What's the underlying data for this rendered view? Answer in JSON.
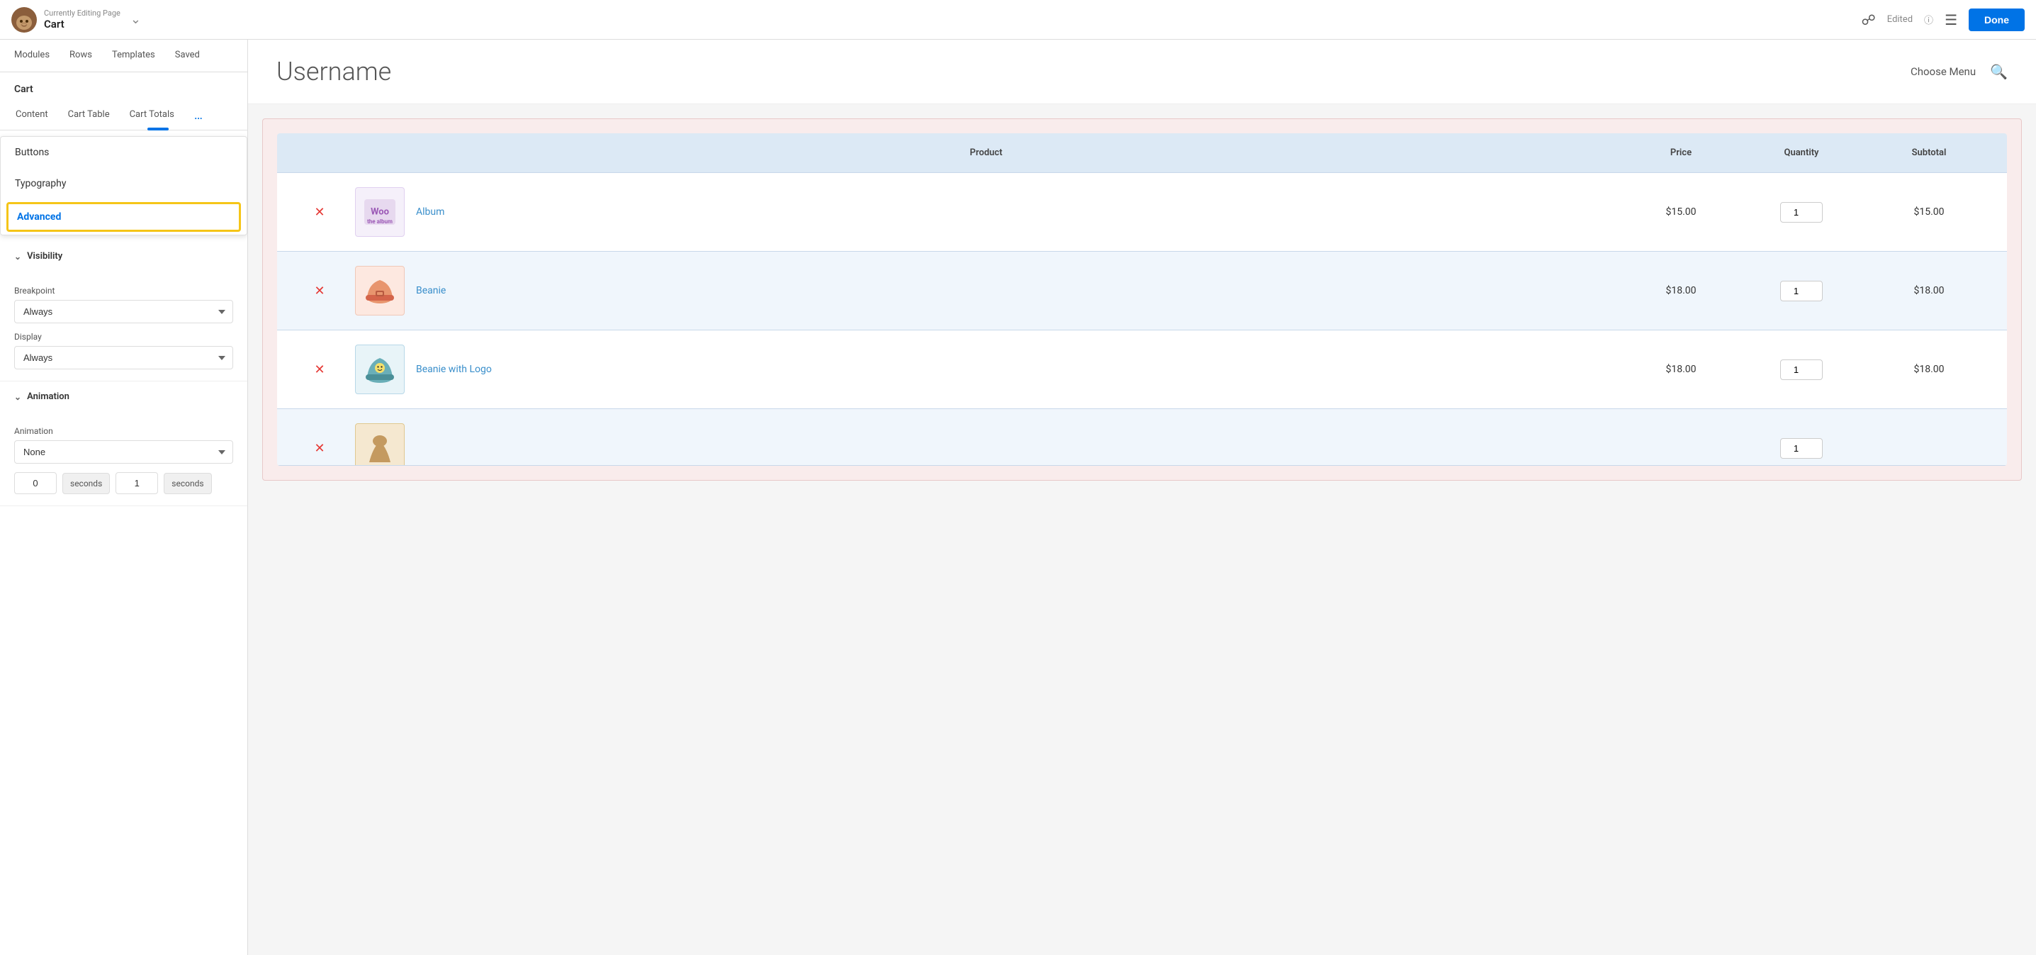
{
  "topbar": {
    "currently_editing": "Currently Editing Page",
    "page_name": "Cart",
    "edited_label": "Edited",
    "done_label": "Done"
  },
  "sidebar": {
    "title": "Cart",
    "nav_tabs": [
      {
        "label": "Modules",
        "active": false
      },
      {
        "label": "Rows",
        "active": false
      },
      {
        "label": "Templates",
        "active": false
      },
      {
        "label": "Saved",
        "active": false
      }
    ],
    "content_tabs": [
      {
        "label": "Content",
        "active": false
      },
      {
        "label": "Cart Table",
        "active": false
      },
      {
        "label": "Cart Totals",
        "active": false
      }
    ],
    "dropdown_items": [
      {
        "label": "Buttons",
        "active": false
      },
      {
        "label": "Typography",
        "active": false
      },
      {
        "label": "Advanced",
        "active": true
      }
    ],
    "visibility_section": {
      "title": "Visibility",
      "breakpoint_label": "Breakpoint",
      "breakpoint_value": "Always",
      "display_label": "Display",
      "display_value": "Always"
    },
    "animation_section": {
      "title": "Animation",
      "animation_label": "Animation",
      "animation_value": "None",
      "delay_value": "0",
      "delay_unit": "seconds",
      "duration_value": "1",
      "duration_unit": "seconds"
    }
  },
  "page": {
    "title": "Username",
    "choose_menu": "Choose Menu"
  },
  "cart": {
    "columns": [
      "",
      "Product",
      "Price",
      "Quantity",
      "Subtotal"
    ],
    "rows": [
      {
        "product_name": "Album",
        "price": "$15.00",
        "quantity": "1",
        "subtotal": "$15.00",
        "thumb_type": "woo"
      },
      {
        "product_name": "Beanie",
        "price": "$18.00",
        "quantity": "1",
        "subtotal": "$18.00",
        "thumb_type": "beanie"
      },
      {
        "product_name": "Beanie with Logo",
        "price": "$18.00",
        "quantity": "1",
        "subtotal": "$18.00",
        "thumb_type": "beanie-logo"
      },
      {
        "product_name": "",
        "price": "",
        "quantity": "",
        "subtotal": "",
        "thumb_type": "partial"
      }
    ]
  }
}
